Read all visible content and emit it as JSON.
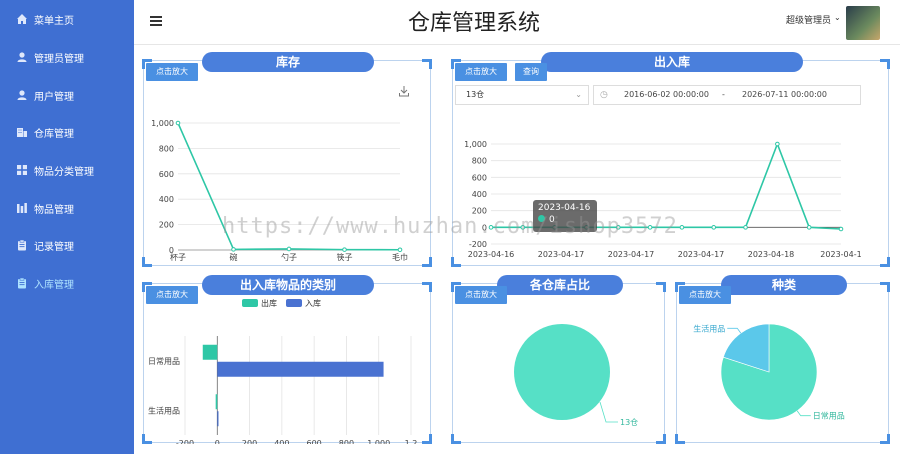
{
  "header": {
    "title": "仓库管理系统",
    "user": "超级管理员",
    "caret": "⌄"
  },
  "sidebar": {
    "items": [
      {
        "label": "菜单主页",
        "icon": "home-icon"
      },
      {
        "label": "管理员管理",
        "icon": "user-icon"
      },
      {
        "label": "用户管理",
        "icon": "user-icon"
      },
      {
        "label": "仓库管理",
        "icon": "building-icon"
      },
      {
        "label": "物品分类管理",
        "icon": "grid-icon"
      },
      {
        "label": "物品管理",
        "icon": "bars-icon"
      },
      {
        "label": "记录管理",
        "icon": "clipboard-icon"
      },
      {
        "label": "入库管理",
        "icon": "clipboard-icon"
      }
    ]
  },
  "common": {
    "zoom_label": "点击放大"
  },
  "inventory": {
    "title": "库存"
  },
  "inout": {
    "title": "出入库",
    "query_label": "查询",
    "warehouse": "13仓",
    "date_start": "2016-06-02 00:00:00",
    "date_sep": "-",
    "date_end": "2026-07-11 00:00:00",
    "tooltip_date": "2023-04-16",
    "tooltip_value": "0"
  },
  "category": {
    "title": "出入库物品的类别"
  },
  "share": {
    "title": "各仓库占比"
  },
  "kind": {
    "title": "种类"
  },
  "watermark": "https://www.huzhan.com/ishop3572",
  "colors": {
    "sidebar": "#3f6fd2",
    "accent": "#4a7fdc",
    "teal": "#2ec7a6",
    "pie": "#56e0c6",
    "blue": "#4a72d1",
    "lightblue": "#5bc8ea"
  },
  "chart_data": [
    {
      "type": "line",
      "categories": [
        "杯子",
        "碗",
        "勺子",
        "筷子",
        "毛巾"
      ],
      "values": [
        1000,
        5,
        8,
        3,
        2
      ],
      "ylim": [
        0,
        1000
      ],
      "yticks": [
        "0",
        "200",
        "400",
        "600",
        "800",
        "1,000"
      ],
      "grid": true
    },
    {
      "type": "line",
      "categories": [
        "2023-04-16",
        "2023-04-17",
        "2023-04-17",
        "2023-04-17",
        "2023-04-18",
        "2023-04-1"
      ],
      "values": [
        0,
        0,
        0,
        0,
        0,
        0,
        0,
        0,
        0,
        1000,
        0,
        -20
      ],
      "ylim": [
        -200,
        1000
      ],
      "yticks": [
        "-200",
        "0",
        "200",
        "400",
        "600",
        "800",
        "1,000"
      ],
      "grid": true
    },
    {
      "type": "bar",
      "orientation": "horizontal",
      "categories": [
        "生活用品",
        "日常用品"
      ],
      "series": [
        {
          "name": "出库",
          "values": [
            -10,
            -90
          ]
        },
        {
          "name": "入库",
          "values": [
            0,
            1030
          ]
        }
      ],
      "xlim": [
        -200,
        1200
      ],
      "xticks": [
        "-200",
        "0",
        "200",
        "400",
        "600",
        "800",
        "1,000",
        "1,2"
      ],
      "grid": true
    },
    {
      "type": "pie",
      "labels": [
        "13仓"
      ],
      "values": [
        100
      ]
    },
    {
      "type": "pie",
      "labels": [
        "日常用品",
        "生活用品"
      ],
      "values": [
        80,
        20
      ]
    }
  ]
}
